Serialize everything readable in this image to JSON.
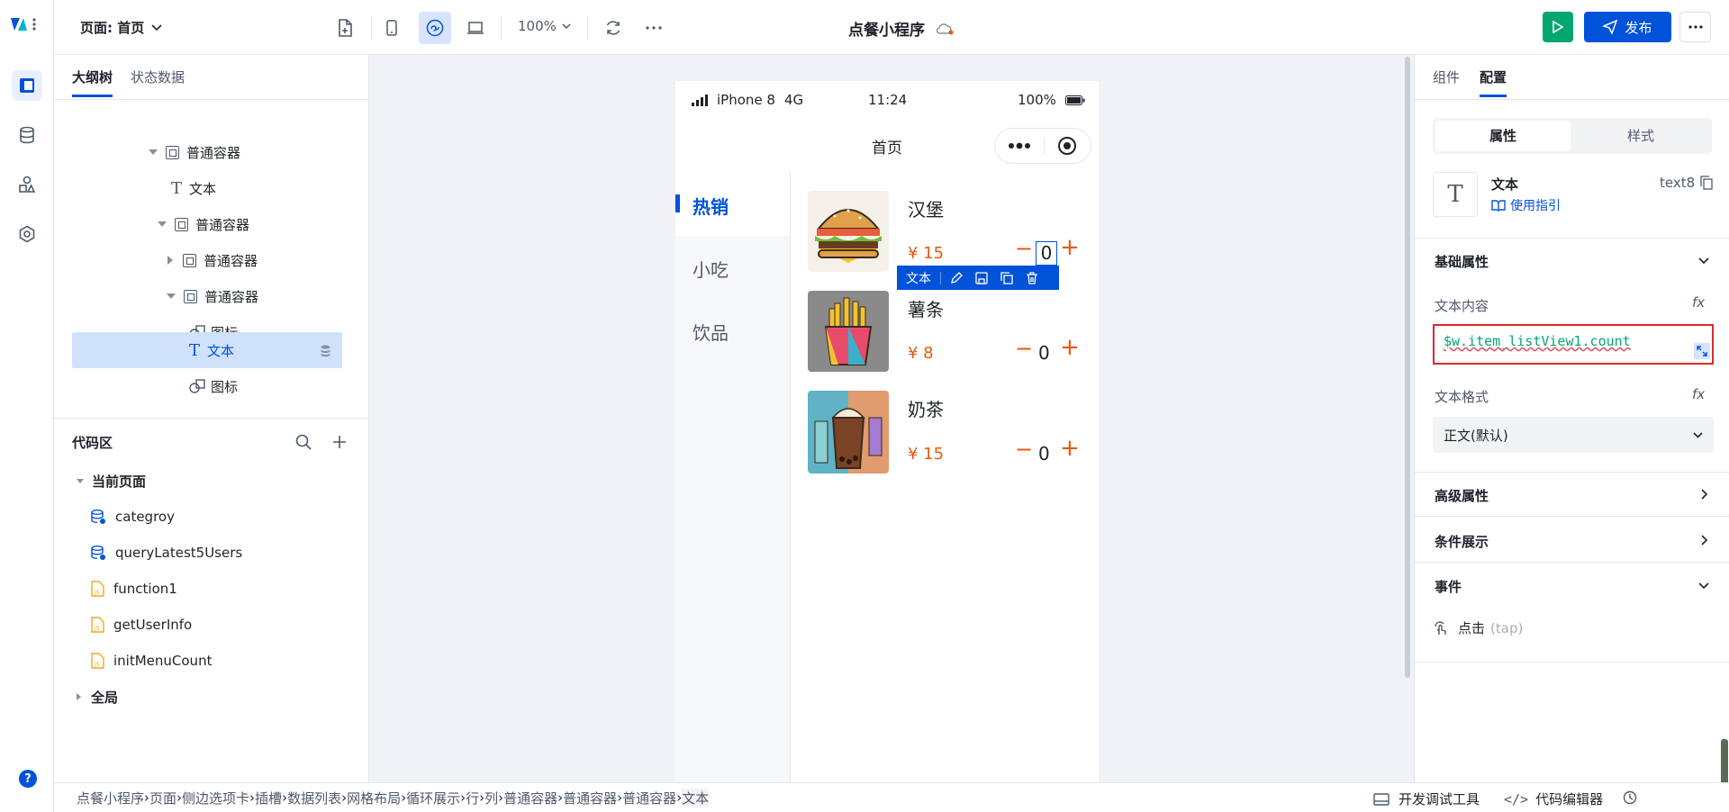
{
  "topbar": {
    "page_label": "页面: 首页",
    "zoom": "100%",
    "app_title": "点餐小程序",
    "publish_label": "发布"
  },
  "left_panel": {
    "tabs": [
      "大纲树",
      "状态数据"
    ],
    "tree": [
      {
        "label": "普通容器"
      },
      {
        "label": "文本"
      },
      {
        "label": "普通容器"
      },
      {
        "label": "普通容器"
      },
      {
        "label": "普通容器"
      },
      {
        "label": "图标"
      },
      {
        "label": "文本"
      },
      {
        "label": "图标"
      }
    ],
    "code_area": {
      "title": "代码区",
      "current_page": "当前页面",
      "items": [
        "categroy",
        "queryLatest5Users",
        "function1",
        "getUserInfo",
        "initMenuCount"
      ],
      "global": "全局"
    }
  },
  "phone": {
    "status": {
      "carrier": "iPhone 8",
      "network": "4G",
      "time": "11:24",
      "battery": "100%"
    },
    "nav_title": "首页",
    "side_menu": [
      "热销",
      "小吃",
      "饮品"
    ],
    "items": [
      {
        "name": "汉堡",
        "price": "¥ 15",
        "count": "0"
      },
      {
        "name": "薯条",
        "price": "¥ 8",
        "count": "0"
      },
      {
        "name": "奶茶",
        "price": "¥ 15",
        "count": "0"
      }
    ],
    "toolbar_label": "文本",
    "minus": "−",
    "plus": "+"
  },
  "right_panel": {
    "tabs": [
      "组件",
      "配置"
    ],
    "seg": [
      "属性",
      "样式"
    ],
    "component": {
      "name": "文本",
      "guide": "使用指引",
      "id": "text8"
    },
    "basic_props": "基础属性",
    "text_content_label": "文本内容",
    "text_content_value": "$w.item_listView1.count",
    "text_format_label": "文本格式",
    "text_format_value": "正文(默认)",
    "advanced": "高级属性",
    "conditional": "条件展示",
    "events": "事件",
    "event_tap": "点击",
    "event_tap_hint": "(tap)",
    "fx": "fx"
  },
  "bottombar": {
    "breadcrumb": [
      "点餐小程序",
      "页面",
      "侧边选项卡",
      "插槽",
      "数据列表",
      "网格布局",
      "循环展示",
      "行",
      "列",
      "普通容器",
      "普通容器",
      "普通容器",
      "文本"
    ],
    "debug": "开发调试工具",
    "code_editor": "代码编辑器"
  },
  "colors": {
    "accent": "#0052d9",
    "price": "#e8590c",
    "run": "#00a870",
    "highlight": "#d0e1fb"
  }
}
